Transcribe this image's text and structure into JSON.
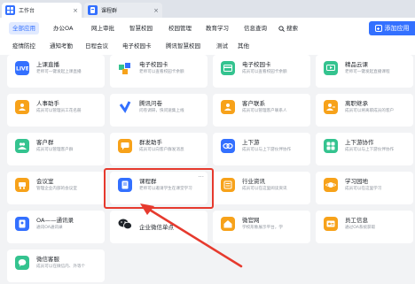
{
  "tabs": [
    {
      "label": "工作台",
      "close": "×"
    },
    {
      "label": "课程群",
      "close": "×"
    }
  ],
  "nav": {
    "row1": [
      "全部应用",
      "办公OA",
      "网上审批",
      "智慧校园",
      "校园管理",
      "教育学习",
      "信息查询"
    ],
    "search_label": "搜索",
    "row2": [
      "疫情防控",
      "通知考勤",
      "日程会议",
      "电子校园卡",
      "腾讯智慧校园",
      "测试",
      "其他"
    ],
    "add_button": "添加应用"
  },
  "cards": [
    {
      "title": "上课直播",
      "desc": "老师可一键发起上课直播",
      "icon": "live-icon",
      "color": "#3370ff"
    },
    {
      "title": "电子校园卡",
      "desc": "老师可以查看校园卡余额",
      "icon": "campus-card-icon",
      "color": "#34c38f"
    },
    {
      "title": "电子校园卡",
      "desc": "成员可以查看校园卡余额",
      "icon": "campus-card-icon",
      "color": "#34c38f"
    },
    {
      "title": "精品云课",
      "desc": "老师可一键发起直播课程",
      "icon": "cloud-class-icon",
      "color": "#34c38f"
    },
    {
      "title": "人事助手",
      "desc": "成员可以管理员工花名册",
      "icon": "hr-icon",
      "color": "#f7a21a"
    },
    {
      "title": "腾讯问卷",
      "desc": "问卷调研，快问速集上线",
      "icon": "survey-icon",
      "color": "#3370ff"
    },
    {
      "title": "客户联系",
      "desc": "成员可以管理客户联系人",
      "icon": "customer-contact-icon",
      "color": "#f7a21a"
    },
    {
      "title": "离职继承",
      "desc": "成员可以将离职成员的客户",
      "icon": "resign-inherit-icon",
      "color": "#f7a21a"
    },
    {
      "title": "客户群",
      "desc": "成员可以管理客户群",
      "icon": "customer-group-icon",
      "color": "#34c38f"
    },
    {
      "title": "群发助手",
      "desc": "成员可以向客户群发消息",
      "icon": "mass-send-icon",
      "color": "#f7a21a"
    },
    {
      "title": "上下游",
      "desc": "成员可以与上下游伙伴协作",
      "icon": "link-icon",
      "color": "#3370ff"
    },
    {
      "title": "上下游协作",
      "desc": "成员可以与上下游伙伴协作",
      "icon": "grid-icon",
      "color": "#34c38f"
    },
    {
      "title": "会议室",
      "desc": "管理企业内部的会议室",
      "icon": "meeting-room-icon",
      "color": "#f7a21a"
    },
    {
      "title": "课程群",
      "desc": "老师可以邀请学生在课堂学习",
      "icon": "course-group-icon",
      "color": "#3370ff",
      "more": "···"
    },
    {
      "title": "行业资讯",
      "desc": "成员可以在这里阅读资讯",
      "icon": "news-icon",
      "color": "#f7a21a"
    },
    {
      "title": "学习园地",
      "desc": "成员可以在这里学习",
      "icon": "study-icon",
      "color": "#f7a21a"
    },
    {
      "title": "OA——通讯录",
      "desc": "通讯OA通讯录",
      "icon": "oa-contacts-icon",
      "color": "#3370ff"
    },
    {
      "title": "企业微信单点",
      "desc": "",
      "icon": "wechat-icon",
      "color": "#ffffff"
    },
    {
      "title": "微官网",
      "desc": "学校形象展示平台，学",
      "icon": "micro-site-icon",
      "color": "#f7a21a"
    },
    {
      "title": "员工信息",
      "desc": "通过OA系统获取",
      "icon": "staff-info-icon",
      "color": "#f7a21a"
    },
    {
      "title": "微信客服",
      "desc": "成员可以在微信内、外等个",
      "icon": "wechat-service-icon",
      "color": "#34c38f"
    }
  ]
}
